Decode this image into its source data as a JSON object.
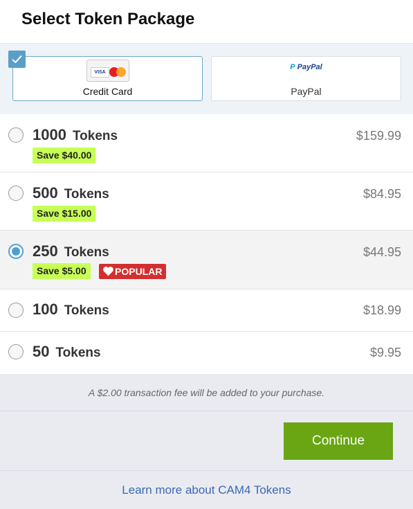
{
  "header": {
    "title": "Select Token Package"
  },
  "payment": {
    "options": [
      {
        "label": "Credit Card",
        "selected": true,
        "icon": "credit-card-logos-icon"
      },
      {
        "label": "PayPal",
        "selected": false,
        "icon": "paypal-logo-icon",
        "logo_text_p": "P",
        "logo_text": "PayPal"
      }
    ],
    "card_logo_visa": "VISA"
  },
  "packages": [
    {
      "amount": "1000",
      "unit": "Tokens",
      "price": "$159.99",
      "save": "Save $40.00",
      "selected": false
    },
    {
      "amount": "500",
      "unit": "Tokens",
      "price": "$84.95",
      "save": "Save $15.00",
      "selected": false
    },
    {
      "amount": "250",
      "unit": "Tokens",
      "price": "$44.95",
      "save": "Save $5.00",
      "badge": "POPULAR",
      "selected": true
    },
    {
      "amount": "100",
      "unit": "Tokens",
      "price": "$18.99",
      "selected": false
    },
    {
      "amount": "50",
      "unit": "Tokens",
      "price": "$9.95",
      "selected": false
    }
  ],
  "footer": {
    "fee_note": "A $2.00 transaction fee will be added to your purchase.",
    "continue_label": "Continue",
    "learn_more": "Learn more about CAM4 Tokens"
  },
  "colors": {
    "accent_blue": "#4d9fd0",
    "continue_green": "#6aa513",
    "save_highlight": "#c8ff57",
    "popular_red": "#d32f2f",
    "link_blue": "#3a68b2"
  }
}
